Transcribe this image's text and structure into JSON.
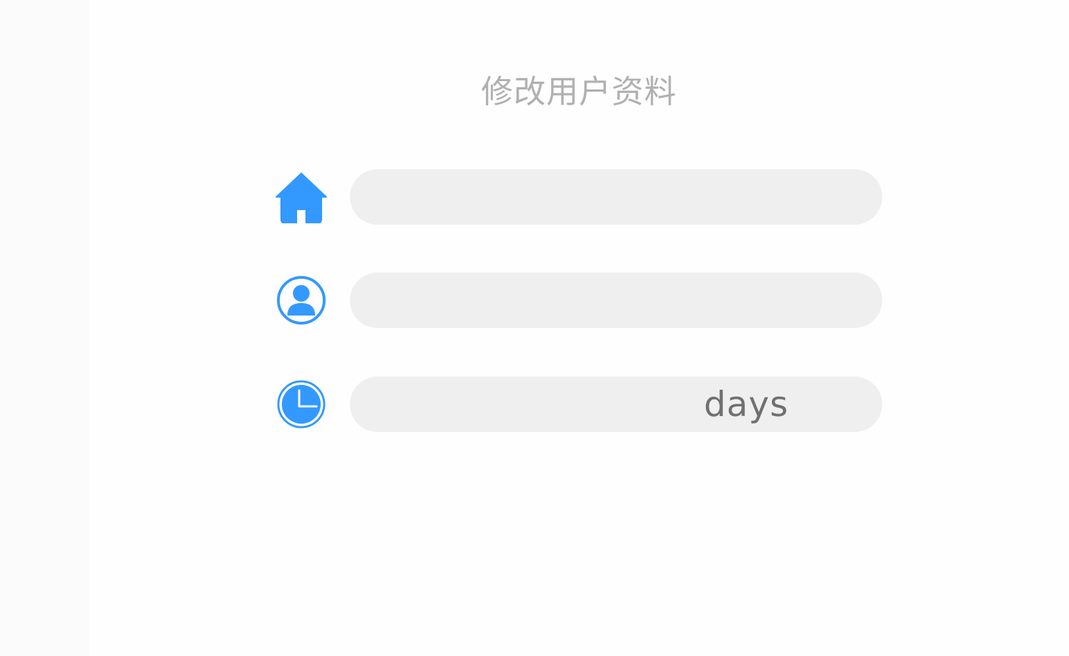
{
  "page": {
    "title": "修改用户资料"
  },
  "form": {
    "home_field": {
      "icon": "home-icon",
      "value": "",
      "placeholder": ""
    },
    "user_field": {
      "icon": "user-icon",
      "value": "",
      "placeholder": ""
    },
    "days_field": {
      "icon": "clock-icon",
      "value": "",
      "placeholder": "",
      "suffix": "days"
    }
  },
  "colors": {
    "accent": "#3399ff",
    "field_bg": "#efefef",
    "title_text": "#b0b0b0",
    "suffix_text": "#707070"
  }
}
